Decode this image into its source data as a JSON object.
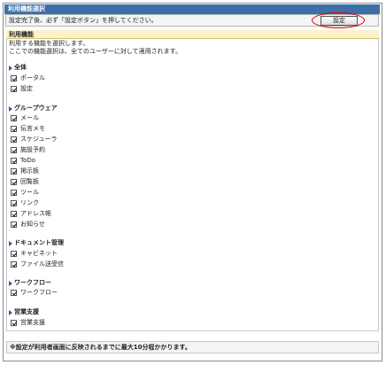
{
  "window": {
    "title": "利用機能選択"
  },
  "notice": {
    "text": "設定完了後、必ず「設定ボタン」を押してください。",
    "set_button": "設定"
  },
  "section": {
    "title": "利用機能",
    "desc1": "利用する機能を選択します。",
    "desc2": "ここでの機能選択は、全てのユーザーに対して適用されます。"
  },
  "groups": [
    {
      "title": "全体",
      "items": [
        "ポータル",
        "設定"
      ]
    },
    {
      "title": "グループウェア",
      "items": [
        "メール",
        "伝言メモ",
        "スケジューラ",
        "施設予約",
        "ToDo",
        "掲示板",
        "回覧板",
        "ツール",
        "リンク",
        "アドレス帳",
        "お知らせ"
      ]
    },
    {
      "title": "ドキュメント管理",
      "items": [
        "キャビネット",
        "ファイル送受信"
      ]
    },
    {
      "title": "ワークフロー",
      "items": [
        "ワークフロー"
      ]
    },
    {
      "title": "営業支援",
      "items": [
        "営業支援"
      ]
    }
  ],
  "footer": {
    "text": "※設定が利用者画面に反映されるまでに最大10分程かかります。"
  }
}
